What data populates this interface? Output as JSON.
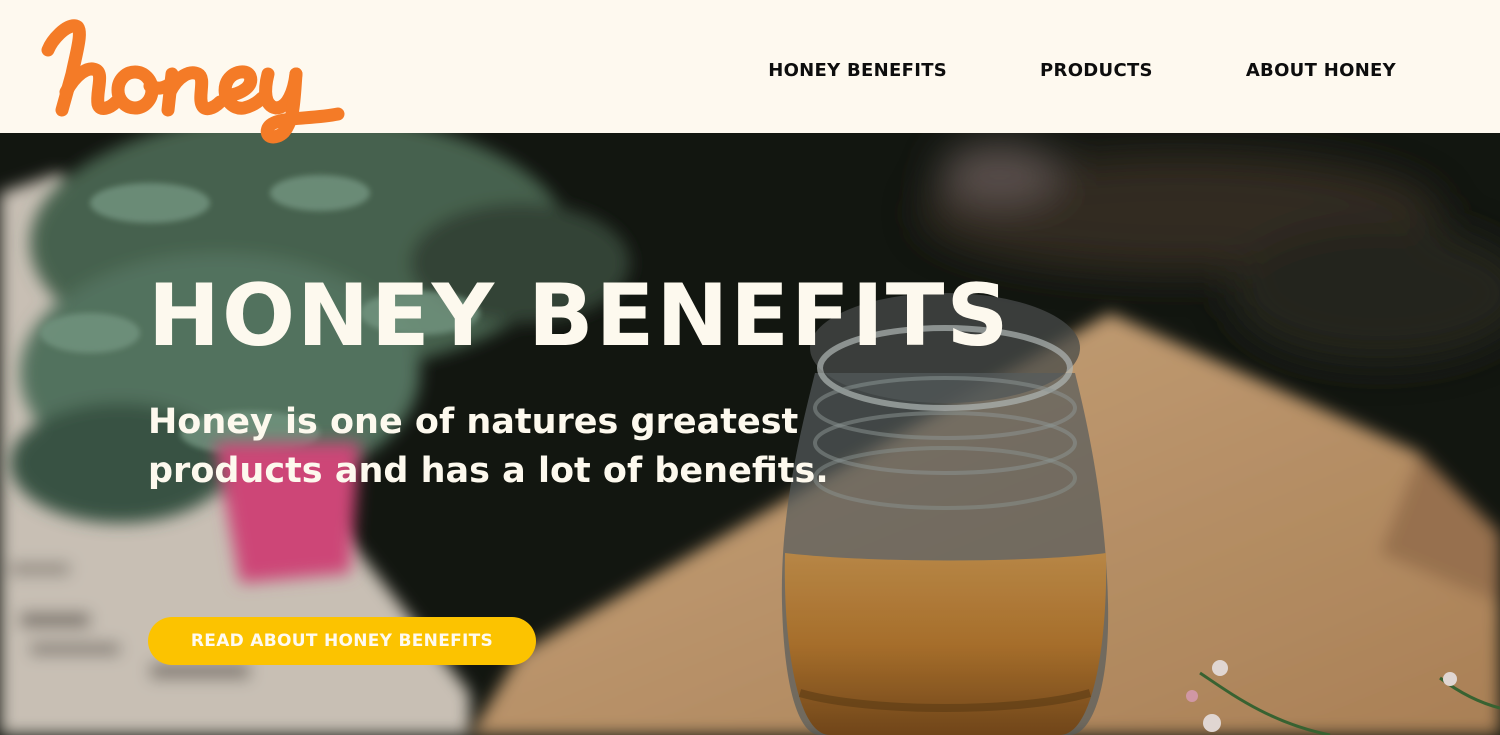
{
  "brand": {
    "logo_text": "honey",
    "logo_color": "#f47b27"
  },
  "nav": {
    "items": [
      {
        "label": "HONEY BENEFITS"
      },
      {
        "label": "PRODUCTS"
      },
      {
        "label": "ABOUT HONEY"
      }
    ]
  },
  "hero": {
    "title": "HONEY BENEFITS",
    "subtitle": "Honey is one of natures greatest products and has a lot of benefits.",
    "cta_label": "READ ABOUT HONEY BENEFITS",
    "cta_color": "#fcc300",
    "background": "photo-of-honey-jar-on-wooden-board-with-herbs"
  }
}
